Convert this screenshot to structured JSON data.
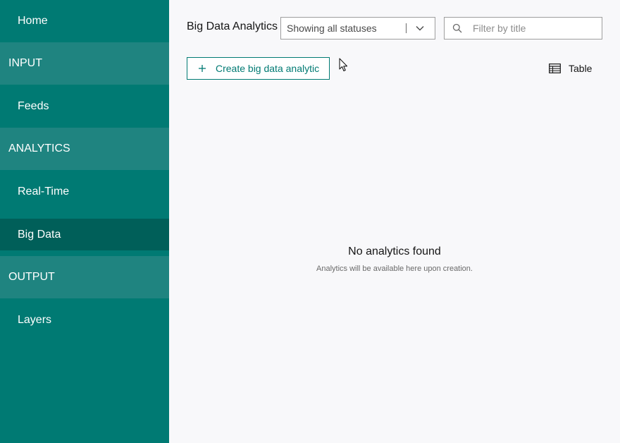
{
  "sidebar": {
    "items": [
      {
        "label": "Home",
        "type": "item"
      },
      {
        "label": "INPUT",
        "type": "header"
      },
      {
        "label": "Feeds",
        "type": "item"
      },
      {
        "label": "ANALYTICS",
        "type": "header"
      },
      {
        "label": "Real-Time",
        "type": "item"
      },
      {
        "label": "Big Data",
        "type": "item",
        "selected": true
      },
      {
        "label": "OUTPUT",
        "type": "header"
      },
      {
        "label": "Layers",
        "type": "item"
      }
    ]
  },
  "header": {
    "title": "Big Data Analytics",
    "status_filter": {
      "value": "Showing all statuses",
      "icon": "chevron-down-icon"
    },
    "search": {
      "placeholder": "Filter by title",
      "icon": "search-icon"
    }
  },
  "toolbar": {
    "create_label": "Create big data analytic",
    "create_icon": "plus-icon",
    "view_label": "Table",
    "view_icon": "table-icon"
  },
  "empty_state": {
    "title": "No analytics found",
    "subtitle": "Analytics will be available here upon creation."
  },
  "colors": {
    "sidebar_bg": "#007a73",
    "sidebar_header_bg": "#1f8480",
    "sidebar_selected_bg": "#005f59",
    "accent": "#007a73",
    "content_bg": "#f8f8fa"
  }
}
